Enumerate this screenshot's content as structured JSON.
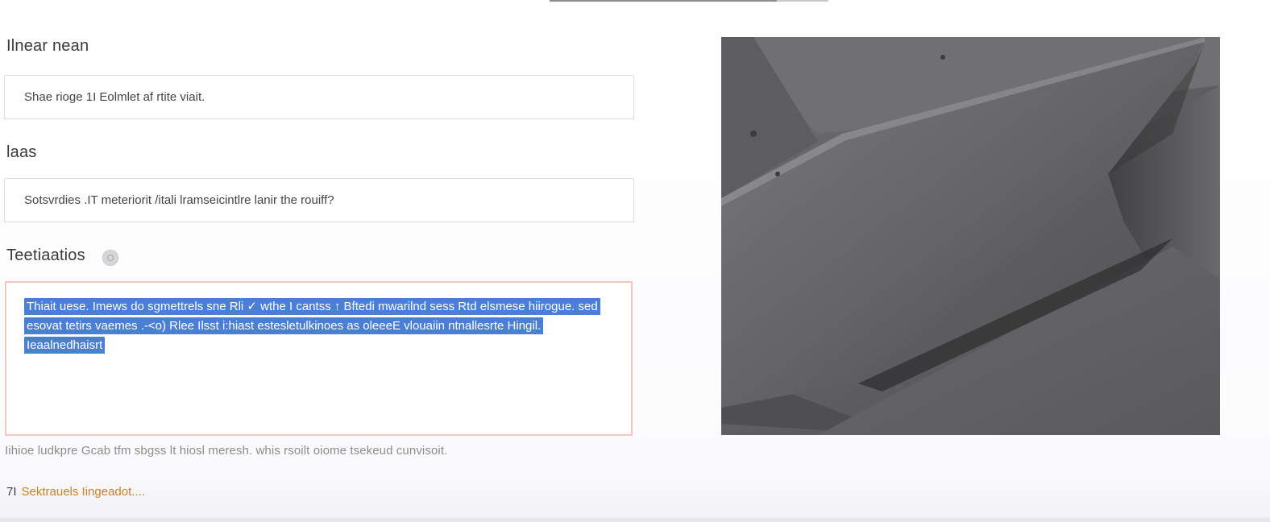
{
  "top_scrollbar": {
    "visible": true
  },
  "form": {
    "field1": {
      "label": "Ilnear nean",
      "value": "Shae rioge 1I Eolmlet af rtite viait."
    },
    "field2": {
      "label": "laas",
      "value": "Sotsvrdies .IT meteriorit /itali lramseicintlre lanir the rouiff?"
    },
    "field3": {
      "label": "Teetiaatios",
      "help_icon": "help-circle-icon",
      "selected_text": "Thiait uese. Imews do sgmettrels sne Rli ✓ wthe I cantss ↑ Bftedi mwarilnd sess Rtd elsmese hiirogue. sed esovat tetirs vaemes .-<o) Rlee Ilsst i:hiast estesletulkinoes as oleeeE vlouaiin ntnallesrte Hingil. Ieaalnedhaisrt",
      "selection_color": "#4a7fd4",
      "border_color": "#f0c8c0"
    },
    "hint": "Iihioe ludkpre Gcab tfm sbgss lt hiosl meresh. whis rsoilt oiome tsekeud cunvisoit.",
    "link": {
      "number": "7I",
      "label": "Sektrauels Iingeadot....",
      "color": "#c9812a"
    }
  },
  "image": {
    "subject": "slate-rock-photo"
  }
}
